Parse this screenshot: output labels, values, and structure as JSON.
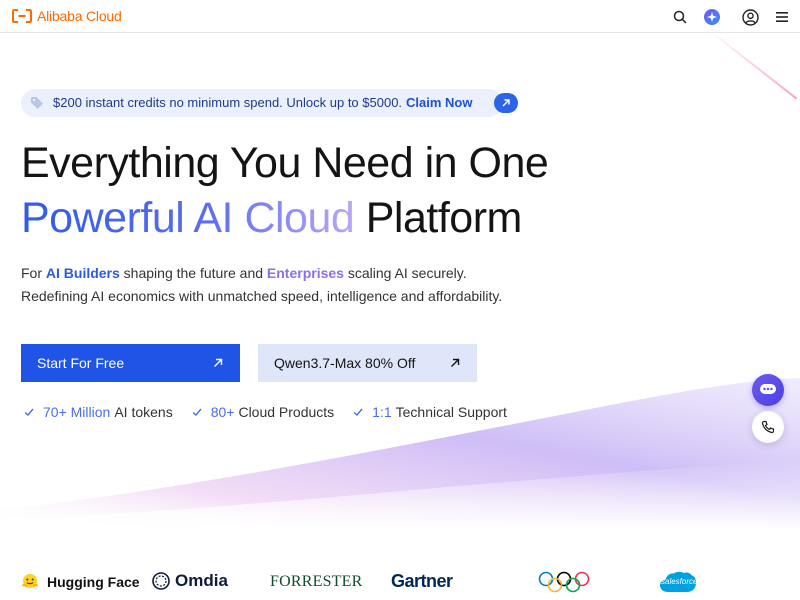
{
  "header": {
    "brand": "Alibaba Cloud",
    "icons": [
      "search-icon",
      "ai-assistant-icon",
      "account-icon",
      "menu-icon"
    ]
  },
  "promo": {
    "text": "$200 instant credits no minimum spend. Unlock up to $5000.",
    "cta": "Claim Now"
  },
  "hero": {
    "line1": "Everything You Need in One",
    "line2_gradient": "Powerful AI Cloud",
    "line2_rest": "Platform",
    "sub1_prefix": "For ",
    "sub1_hl1": "AI Builders",
    "sub1_mid": " shaping the future and ",
    "sub1_hl2": "Enterprises",
    "sub1_suffix": " scaling AI securely.",
    "sub2": "Redefining AI economics with unmatched speed, intelligence and affordability."
  },
  "cta": {
    "primary": "Start For Free",
    "secondary": "Qwen3.7-Max 80% Off"
  },
  "stats": [
    {
      "number": "70+ Million",
      "label": "AI tokens"
    },
    {
      "number": "80+",
      "label": "Cloud Products"
    },
    {
      "number": "1:1",
      "label": "Technical Support"
    }
  ],
  "partners": {
    "hugging_face": "Hugging Face",
    "omdia": "Omdia",
    "forrester": "FORRESTER",
    "gartner": "Gartner",
    "salesforce": "salesforce"
  },
  "colors": {
    "brand_orange": "#ff6a00",
    "primary_blue": "#1f54e6",
    "accent_purple": "#8b6ff0",
    "promo_bg": "#eaf0fc"
  }
}
